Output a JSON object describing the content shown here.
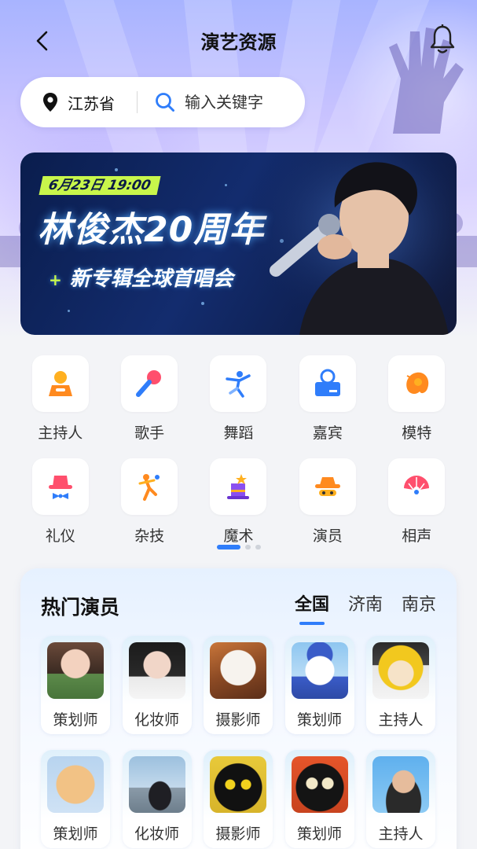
{
  "header": {
    "title": "演艺资源",
    "back_icon": "chevron-left-icon",
    "bell_icon": "bell-icon"
  },
  "search": {
    "location": "江苏省",
    "placeholder": "输入关键字"
  },
  "banner": {
    "date": "6月23日 19:00",
    "headline": "林俊杰20周年",
    "subline": "新专辑全球首唱会"
  },
  "categories": [
    {
      "label": "主持人",
      "icon": "host-icon"
    },
    {
      "label": "歌手",
      "icon": "microphone-icon"
    },
    {
      "label": "舞蹈",
      "icon": "dancer-icon"
    },
    {
      "label": "嘉宾",
      "icon": "guest-icon"
    },
    {
      "label": "模特",
      "icon": "model-icon"
    },
    {
      "label": "礼仪",
      "icon": "etiquette-icon"
    },
    {
      "label": "杂技",
      "icon": "acrobat-icon"
    },
    {
      "label": "魔术",
      "icon": "magic-hat-icon"
    },
    {
      "label": "演员",
      "icon": "actor-icon"
    },
    {
      "label": "相声",
      "icon": "fan-icon"
    }
  ],
  "pager": {
    "pages": 3,
    "active": 0
  },
  "hot": {
    "title": "热门演员",
    "tabs": [
      "全国",
      "济南",
      "南京"
    ],
    "active_tab": 0,
    "people": [
      {
        "label": "策划师"
      },
      {
        "label": "化妆师"
      },
      {
        "label": "摄影师"
      },
      {
        "label": "策划师"
      },
      {
        "label": "主持人"
      },
      {
        "label": "策划师"
      },
      {
        "label": "化妆师"
      },
      {
        "label": "摄影师"
      },
      {
        "label": "策划师"
      },
      {
        "label": "主持人"
      }
    ]
  },
  "colors": {
    "accent": "#2f7dfa",
    "banner_tag": "#c8f64b",
    "orange": "#ff8a1f"
  }
}
